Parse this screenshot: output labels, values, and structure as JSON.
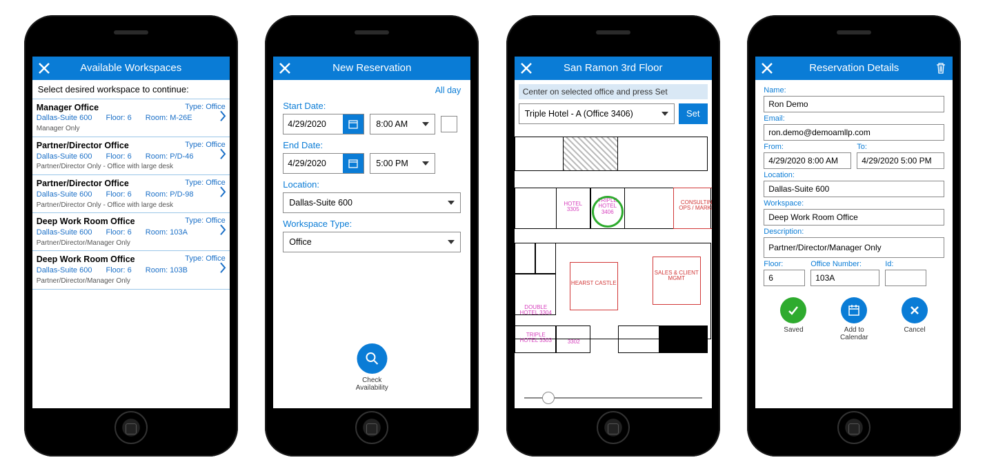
{
  "screen1": {
    "title": "Available Workspaces",
    "instruction": "Select desired workspace to continue:",
    "type_prefix": "Type:",
    "floor_prefix": "Floor:",
    "room_prefix": "Room:",
    "items": [
      {
        "name": "Manager Office",
        "type": "Office",
        "location": "Dallas-Suite 600",
        "floor": "6",
        "room": "M-26E",
        "desc": "Manager Only"
      },
      {
        "name": "Partner/Director Office",
        "type": "Office",
        "location": "Dallas-Suite 600",
        "floor": "6",
        "room": "P/D-46",
        "desc": "Partner/Director Only - Office with large desk"
      },
      {
        "name": "Partner/Director Office",
        "type": "Office",
        "location": "Dallas-Suite 600",
        "floor": "6",
        "room": "P/D-98",
        "desc": "Partner/Director Only - Office with large desk"
      },
      {
        "name": "Deep Work Room Office",
        "type": "Office",
        "location": "Dallas-Suite 600",
        "floor": "6",
        "room": "103A",
        "desc": "Partner/Director/Manager Only"
      },
      {
        "name": "Deep Work Room Office",
        "type": "Office",
        "location": "Dallas-Suite 600",
        "floor": "6",
        "room": "103B",
        "desc": "Partner/Director/Manager Only"
      }
    ]
  },
  "screen2": {
    "title": "New Reservation",
    "allday_label": "All day",
    "start_label": "Start Date:",
    "end_label": "End Date:",
    "location_label": "Location:",
    "wstype_label": "Workspace Type:",
    "start_date": "4/29/2020",
    "start_time": "8:00 AM",
    "end_date": "4/29/2020",
    "end_time": "5:00 PM",
    "location": "Dallas-Suite 600",
    "wstype": "Office",
    "search_label": "Check\nAvailability"
  },
  "screen3": {
    "title": "San Ramon 3rd Floor",
    "hint": "Center on selected office and press Set",
    "office_selected": "Triple Hotel - A (Office 3406)",
    "set_label": "Set",
    "labels": {
      "hotel": "HOTEL\n3305",
      "triple": "TRIPLE\nHOTEL\n3406",
      "consulting": "CONSULTING\nOPS / MARKET",
      "hearst": "HEARST\nCASTLE",
      "sales": "SALES &\nCLIENT\nMGMT",
      "double": "DOUBLE\nHOTEL\n3304",
      "triple2": "TRIPLE\nHOTEL\n3303",
      "r3302": "3302"
    }
  },
  "screen4": {
    "title": "Reservation Details",
    "name_label": "Name:",
    "email_label": "Email:",
    "from_label": "From:",
    "to_label": "To:",
    "location_label": "Location:",
    "workspace_label": "Workspace:",
    "description_label": "Description:",
    "floor_label": "Floor:",
    "office_label": "Office Number:",
    "id_label": "Id:",
    "name": "Ron Demo",
    "email": "ron.demo@demoamllp.com",
    "from": "4/29/2020 8:00 AM",
    "to": "4/29/2020 5:00 PM",
    "location": "Dallas-Suite 600",
    "workspace": "Deep Work Room Office",
    "description": "Partner/Director/Manager Only",
    "floor": "6",
    "office": "103A",
    "id": "",
    "actions": {
      "saved": "Saved",
      "calendar": "Add to\nCalendar",
      "cancel": "Cancel"
    }
  }
}
